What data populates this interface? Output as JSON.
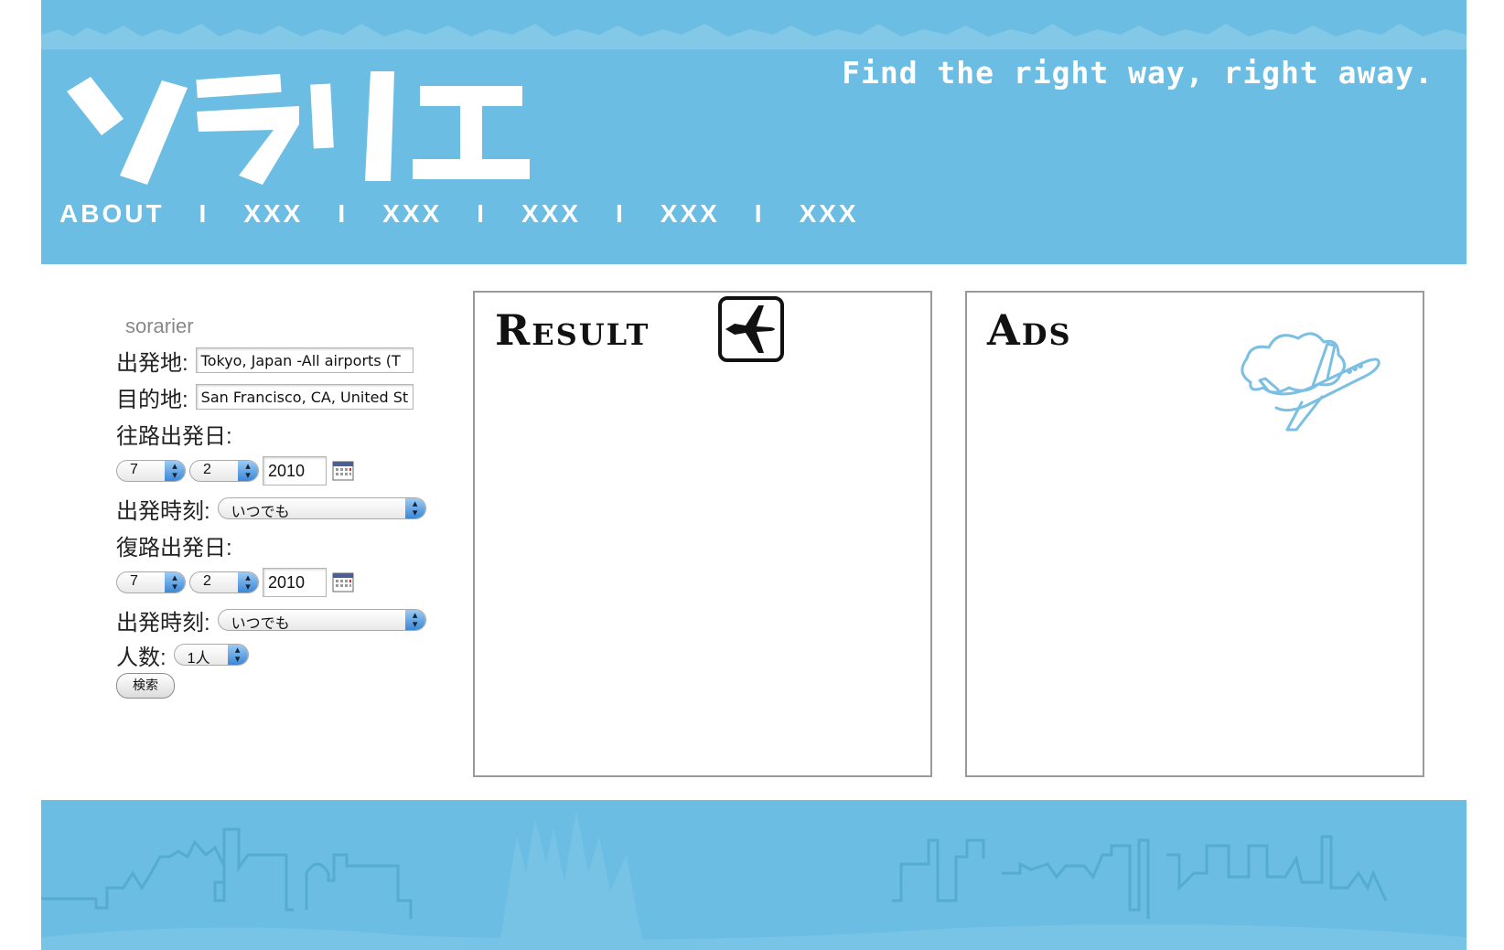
{
  "header": {
    "logo_text": "ソラリエ",
    "tagline": "Find the right way, right away.",
    "nav": [
      "ABOUT",
      "XXX",
      "XXX",
      "XXX",
      "XXX",
      "XXX"
    ],
    "nav_separator": "I"
  },
  "search_form": {
    "brand": "sorarier",
    "departure_label": "出発地:",
    "departure_value": "Tokyo, Japan -All airports (T",
    "destination_label": "目的地:",
    "destination_value": "San Francisco, CA, United St",
    "outbound_date_label": "往路出発日:",
    "outbound_month": "7",
    "outbound_day": "2",
    "outbound_year": "2010",
    "outbound_time_label": "出発時刻:",
    "outbound_time": "いつでも",
    "return_date_label": "復路出発日:",
    "return_month": "7",
    "return_day": "2",
    "return_year": "2010",
    "return_time_label": "出発時刻:",
    "return_time": "いつでも",
    "passengers_label": "人数:",
    "passengers_value": "1人",
    "search_button": "検索"
  },
  "result_panel": {
    "title": "Result"
  },
  "ads_panel": {
    "title": "Ads"
  },
  "colors": {
    "header_bg": "#6bbde3",
    "panel_border": "#9a9a9a",
    "accent_blue": "#3b87d7"
  },
  "icons": [
    "airplane-icon",
    "calendar-icon",
    "cloud-airplane-illustration",
    "select-arrow-icon"
  ]
}
